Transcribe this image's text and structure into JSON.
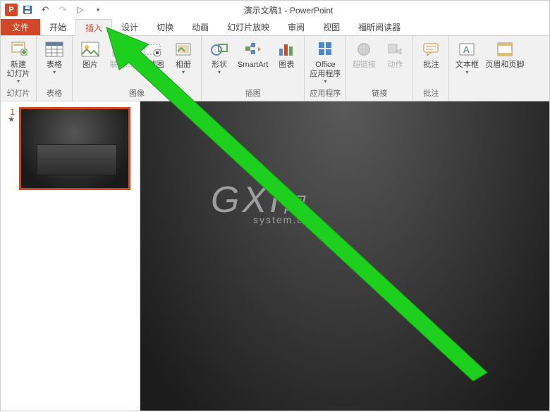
{
  "titlebar": {
    "app_icon_text": "P",
    "document_title": "演示文稿1 - PowerPoint"
  },
  "qat": {
    "save": "💾",
    "undo": "↶",
    "redo": "↷",
    "start": "▷"
  },
  "tabs": {
    "file": "文件",
    "home": "开始",
    "insert": "插入",
    "design": "设计",
    "transitions": "切换",
    "animations": "动画",
    "slideshow": "幻灯片放映",
    "review": "审阅",
    "view": "视图",
    "foxit": "福昕阅读器"
  },
  "ribbon": {
    "slides": {
      "new_slide": "新建\n幻灯片",
      "group": "幻灯片"
    },
    "tables": {
      "table": "表格",
      "group": "表格"
    },
    "images": {
      "pictures": "图片",
      "online_pictures": "联机…",
      "screenshot": "…截图",
      "album": "相册",
      "group": "图像"
    },
    "illustrations": {
      "shapes": "形状",
      "smartart": "SmartArt",
      "chart": "图表",
      "group": "插图"
    },
    "apps": {
      "office_apps": "Office\n应用程序",
      "group": "应用程序"
    },
    "links": {
      "hyperlink": "超链接",
      "action": "动作",
      "group": "链接"
    },
    "comments": {
      "comment": "批注",
      "group": "批注"
    },
    "text": {
      "textbox": "文本框",
      "header_footer": "页眉和页脚"
    }
  },
  "thumb": {
    "number": "1",
    "star": "★"
  },
  "watermark": {
    "big": "GXI",
    "suffix": "网",
    "small": "system.com"
  }
}
